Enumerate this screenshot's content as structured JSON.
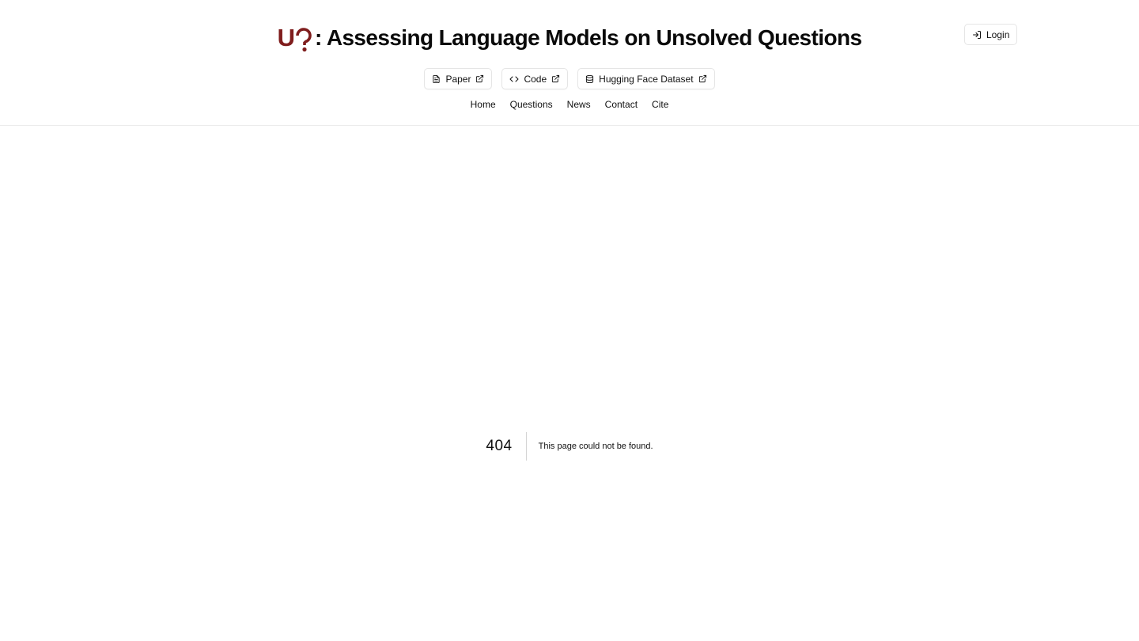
{
  "brand": {
    "logo_text": "UQ",
    "color": "#7f1d1d"
  },
  "header": {
    "title": ": Assessing Language Models on Unsolved Questions",
    "login_label": "Login"
  },
  "links": [
    {
      "label": "Paper",
      "icon": "file-text-icon"
    },
    {
      "label": "Code",
      "icon": "code-icon"
    },
    {
      "label": "Hugging Face Dataset",
      "icon": "database-icon"
    }
  ],
  "nav": [
    "Home",
    "Questions",
    "News",
    "Contact",
    "Cite"
  ],
  "error": {
    "code": "404",
    "message": "This page could not be found."
  }
}
